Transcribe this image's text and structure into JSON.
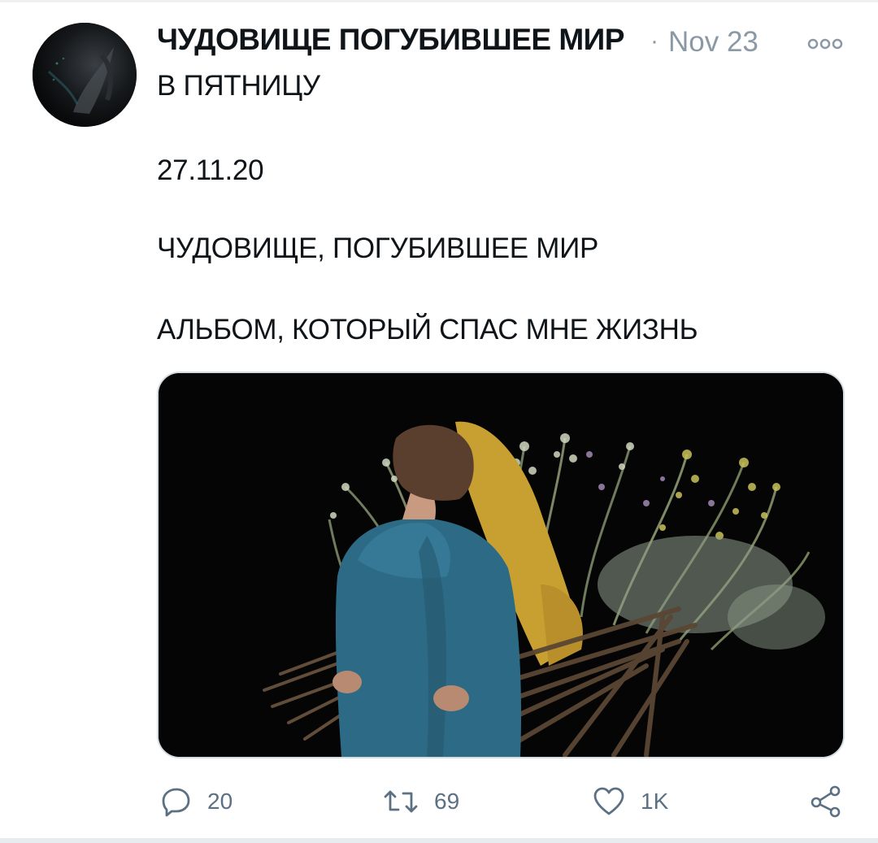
{
  "tweet": {
    "author_name": "ЧУДОВИЩЕ ПОГУБИВШЕЕ МИР",
    "separator": "·",
    "date": "Nov 23",
    "lines": [
      "В ПЯТНИЦУ",
      "27.11.20",
      "ЧУДОВИЩЕ, ПОГУБИВШЕЕ МИР",
      "АЛЬБОМ, КОТОРЫЙ СПАС МНЕ ЖИЗНЬ"
    ]
  },
  "actions": {
    "replies": "20",
    "retweets": "69",
    "likes": "1K"
  },
  "icons": {
    "more": "more-icon",
    "reply": "reply-icon",
    "retweet": "retweet-icon",
    "like": "heart-icon",
    "share": "share-icon"
  },
  "colors": {
    "text": "#0f1419",
    "muted": "#5b7083",
    "timestamp": "#8b98a5",
    "media_background": "#050505"
  }
}
